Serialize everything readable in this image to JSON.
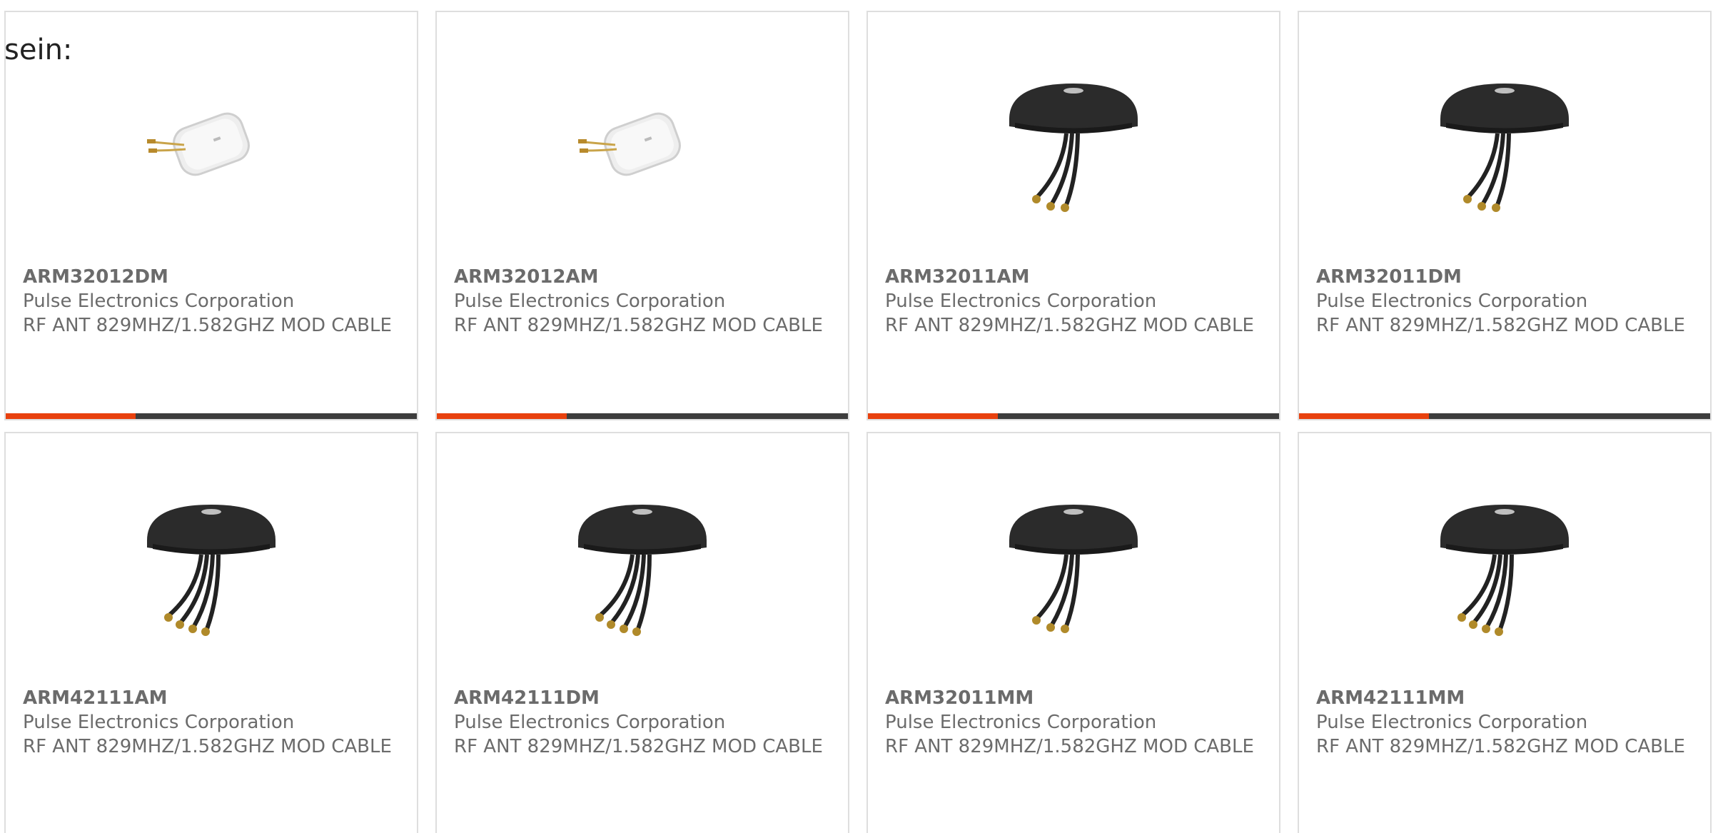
{
  "intro_text": "sein:",
  "colors": {
    "accent": "#e8410e",
    "bar": "#3d3d3d",
    "border": "#dedede",
    "text": "#6b6b6b"
  },
  "products": [
    {
      "part_number": "ARM32012DM",
      "manufacturer": "Pulse Electronics Corporation",
      "description": "RF ANT 829MHZ/1.582GHZ MOD CABLE",
      "image": "white-antenna-2-cable",
      "highlight_bar": true
    },
    {
      "part_number": "ARM32012AM",
      "manufacturer": "Pulse Electronics Corporation",
      "description": "RF ANT 829MHZ/1.582GHZ MOD CABLE",
      "image": "white-antenna-2-cable",
      "highlight_bar": true
    },
    {
      "part_number": "ARM32011AM",
      "manufacturer": "Pulse Electronics Corporation",
      "description": "RF ANT 829MHZ/1.582GHZ MOD CABLE",
      "image": "black-antenna-3-cable",
      "highlight_bar": true
    },
    {
      "part_number": "ARM32011DM",
      "manufacturer": "Pulse Electronics Corporation",
      "description": "RF ANT 829MHZ/1.582GHZ MOD CABLE",
      "image": "black-antenna-3-cable",
      "highlight_bar": true
    },
    {
      "part_number": "ARM42111AM",
      "manufacturer": "Pulse Electronics Corporation",
      "description": "RF ANT 829MHZ/1.582GHZ MOD CABLE",
      "image": "black-antenna-4-cable",
      "highlight_bar": false
    },
    {
      "part_number": "ARM42111DM",
      "manufacturer": "Pulse Electronics Corporation",
      "description": "RF ANT 829MHZ/1.582GHZ MOD CABLE",
      "image": "black-antenna-4-cable",
      "highlight_bar": false
    },
    {
      "part_number": "ARM32011MM",
      "manufacturer": "Pulse Electronics Corporation",
      "description": "RF ANT 829MHZ/1.582GHZ MOD CABLE",
      "image": "black-antenna-3-cable",
      "highlight_bar": false
    },
    {
      "part_number": "ARM42111MM",
      "manufacturer": "Pulse Electronics Corporation",
      "description": "RF ANT 829MHZ/1.582GHZ MOD CABLE",
      "image": "black-antenna-4-cable",
      "highlight_bar": false
    }
  ]
}
